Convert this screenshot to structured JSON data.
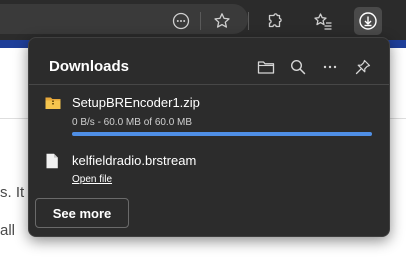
{
  "toolbar": {
    "buttons": [
      "more-options-icon",
      "favorite-icon",
      "extensions-icon",
      "favorites-icon",
      "downloads-icon"
    ]
  },
  "page": {
    "fragment_1": "s. It",
    "fragment_2": "all"
  },
  "downloads": {
    "title": "Downloads",
    "header_icons": [
      "folder-icon",
      "search-icon",
      "more-icon",
      "pin-icon"
    ],
    "items": [
      {
        "name": "SetupBREncoder1.zip",
        "status": "0 B/s - 60.0 MB of 60.0 MB",
        "progress": 1.0,
        "icon": "zip-folder-icon"
      },
      {
        "name": "kelfieldradio.brstream",
        "action": "Open file",
        "icon": "document-icon"
      }
    ],
    "see_more": "See more"
  },
  "colors": {
    "toolbar_bg": "#2b2b2b",
    "flyout_bg": "#2c2c2c",
    "progress": "#4f8fe6",
    "page_accent_bar": "#1f3f99"
  }
}
